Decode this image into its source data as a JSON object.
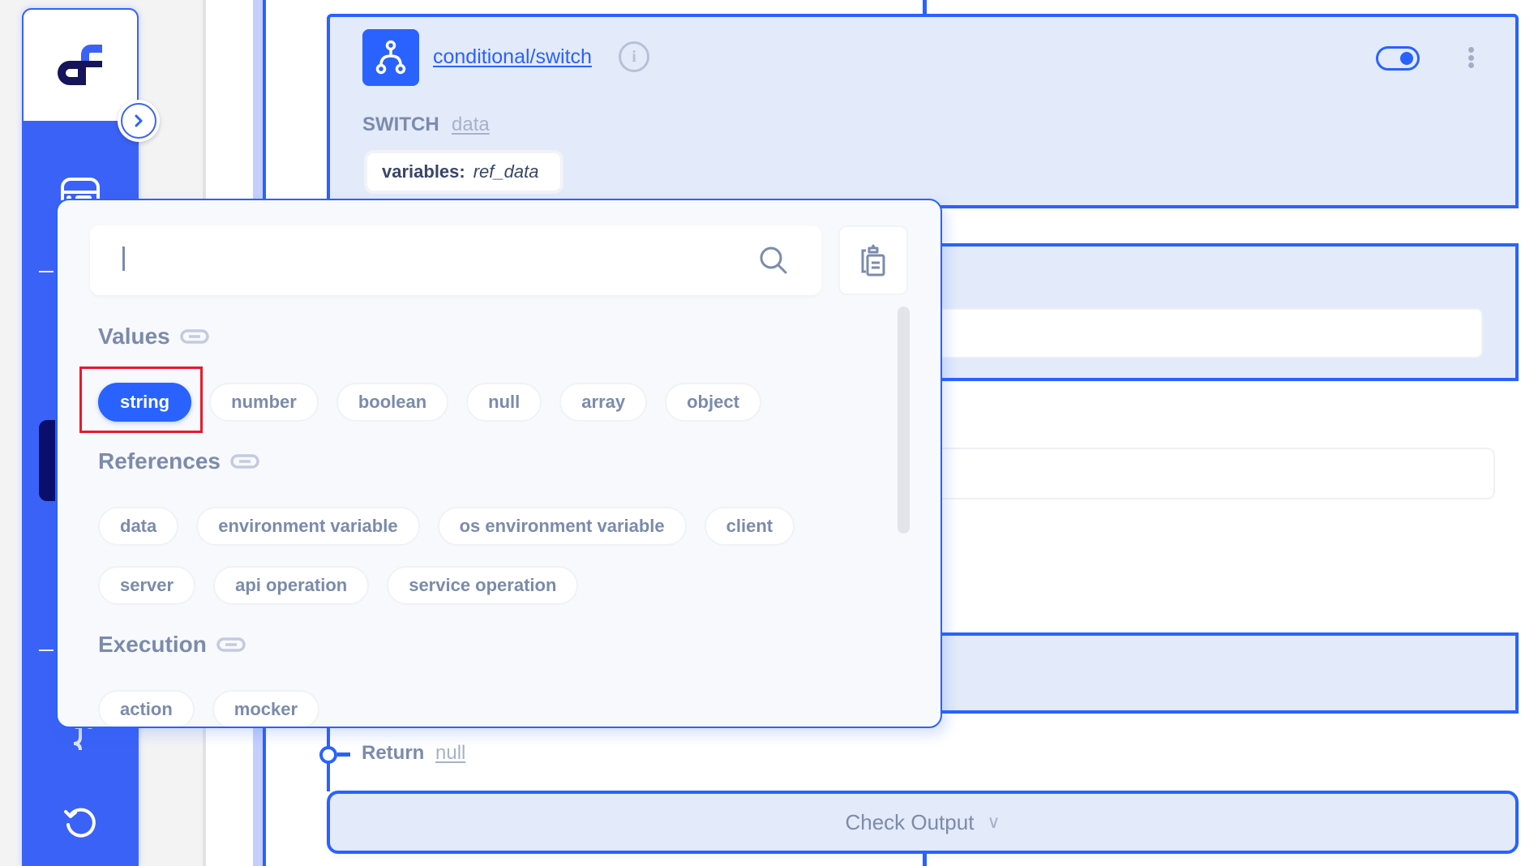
{
  "sidebar": {
    "logo": "df-logo",
    "collapse_icon": "chevron-right-icon",
    "icons": [
      "inbox-icon",
      "settings-cog-icon",
      "history-icon"
    ]
  },
  "node": {
    "type_icon": "branch-icon",
    "title": "conditional/switch",
    "info_icon": "info-icon",
    "enabled": true,
    "menu_icon": "kebab-menu-icon",
    "switch_label": "SWITCH",
    "switch_ref": "data",
    "variables_key": "variables:",
    "variables_value": "ref_data"
  },
  "return_row": {
    "label": "Return",
    "value": "null"
  },
  "check_output": {
    "label": "Check Output",
    "chevron": "∨"
  },
  "popup": {
    "search": {
      "value": "",
      "placeholder": ""
    },
    "sections": [
      {
        "title": "Values",
        "chips": [
          "string",
          "number",
          "boolean",
          "null",
          "array",
          "object"
        ],
        "selected": "string"
      },
      {
        "title": "References",
        "chips": [
          "data",
          "environment variable",
          "os environment variable",
          "client",
          "server",
          "api operation",
          "service operation"
        ]
      },
      {
        "title": "Execution",
        "chips": [
          "action",
          "mocker"
        ]
      }
    ]
  },
  "colors": {
    "accent": "#2962ff",
    "sidebar": "#3b62f6",
    "card_bg": "#e3eaf9",
    "muted_text": "#7b8bac",
    "highlight": "#e8192c"
  }
}
